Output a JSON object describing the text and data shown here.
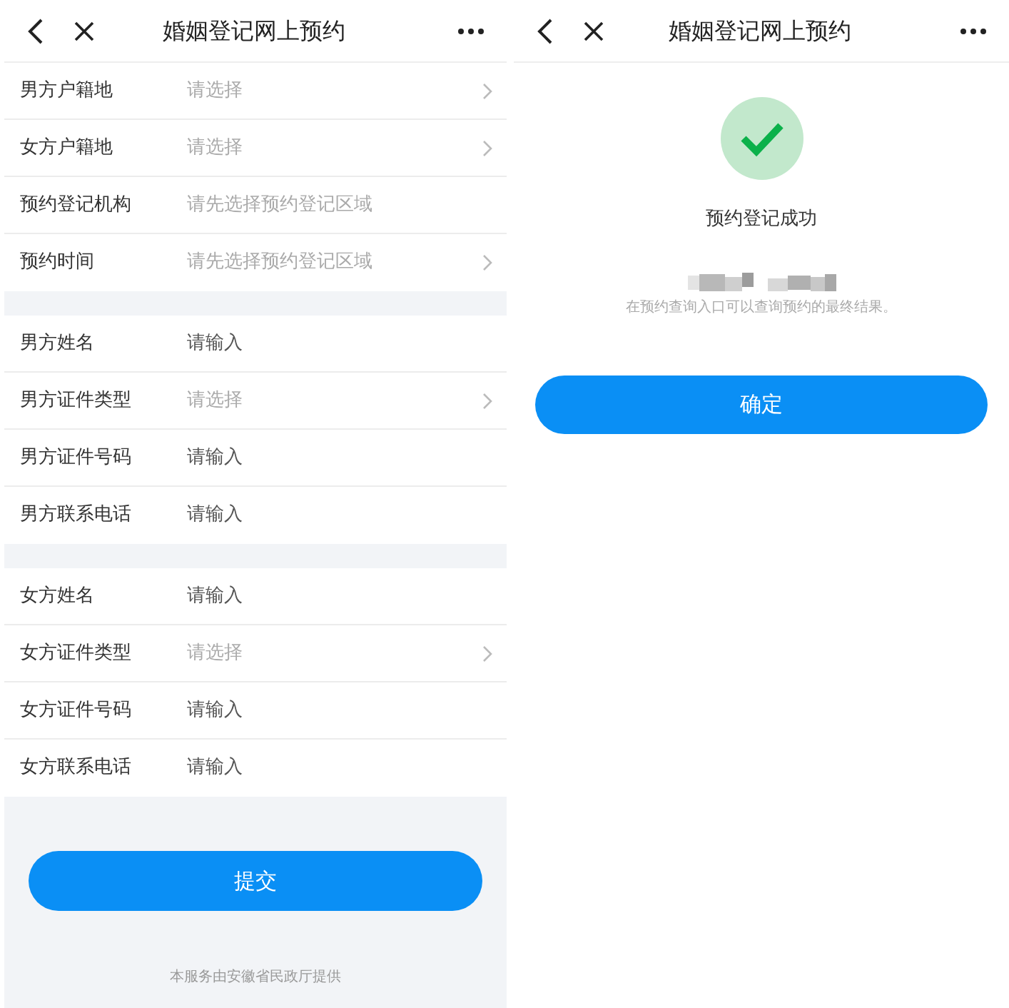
{
  "left": {
    "header": {
      "title": "婚姻登记网上预约"
    },
    "sections": [
      {
        "rows": [
          {
            "label": "男方户籍地",
            "placeholder": "请选择",
            "kind": "select",
            "chevron": true
          },
          {
            "label": "女方户籍地",
            "placeholder": "请选择",
            "kind": "select",
            "chevron": true
          },
          {
            "label": "预约登记机构",
            "placeholder": "请先选择预约登记区域",
            "kind": "select",
            "chevron": false
          },
          {
            "label": "预约时间",
            "placeholder": "请先选择预约登记区域",
            "kind": "select",
            "chevron": true
          }
        ]
      },
      {
        "rows": [
          {
            "label": "男方姓名",
            "placeholder": "请输入",
            "kind": "input",
            "chevron": false
          },
          {
            "label": "男方证件类型",
            "placeholder": "请选择",
            "kind": "select",
            "chevron": true
          },
          {
            "label": "男方证件号码",
            "placeholder": "请输入",
            "kind": "input",
            "chevron": false
          },
          {
            "label": "男方联系电话",
            "placeholder": "请输入",
            "kind": "input",
            "chevron": false
          }
        ]
      },
      {
        "rows": [
          {
            "label": "女方姓名",
            "placeholder": "请输入",
            "kind": "input",
            "chevron": false
          },
          {
            "label": "女方证件类型",
            "placeholder": "请选择",
            "kind": "select",
            "chevron": true
          },
          {
            "label": "女方证件号码",
            "placeholder": "请输入",
            "kind": "input",
            "chevron": false
          },
          {
            "label": "女方联系电话",
            "placeholder": "请输入",
            "kind": "input",
            "chevron": false
          }
        ]
      }
    ],
    "submit_button": "提交",
    "footer": "本服务由安徽省民政厅提供"
  },
  "right": {
    "header": {
      "title": "婚姻登记网上预约"
    },
    "success_message": "预约登记成功",
    "note": "在预约查询入口可以查询预约的最终结果。",
    "confirm_button": "确定"
  }
}
